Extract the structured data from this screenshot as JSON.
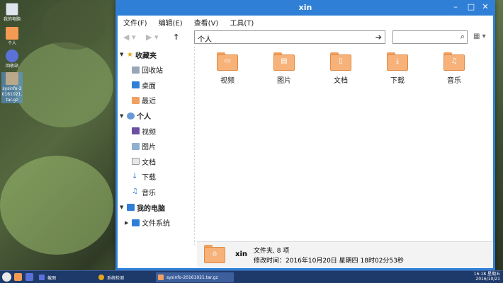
{
  "desktop": {
    "icons": [
      {
        "label": "我的电脑",
        "icon": "computer-icon"
      },
      {
        "label": "个人",
        "icon": "home-icon"
      },
      {
        "label": "回收站",
        "icon": "trash-icon"
      },
      {
        "label": "sysinfo-20161021.tar.gz",
        "icon": "archive-icon"
      }
    ]
  },
  "window": {
    "title": "xin",
    "menu": [
      "文件(F)",
      "编辑(E)",
      "查看(V)",
      "工具(T)"
    ],
    "address": "个人",
    "search_value": "",
    "sidebar": {
      "favorites": {
        "label": "收藏夹",
        "items": [
          "回收站",
          "桌面",
          "最近"
        ]
      },
      "personal": {
        "label": "个人",
        "items": [
          "视频",
          "图片",
          "文档",
          "下载",
          "音乐"
        ]
      },
      "computer": {
        "label": "我的电脑",
        "items": [
          "文件系统"
        ]
      }
    },
    "folders": [
      {
        "label": "视频",
        "icon": "video-icon",
        "sym": "▭"
      },
      {
        "label": "图片",
        "icon": "picture-icon",
        "sym": "▤"
      },
      {
        "label": "文档",
        "icon": "document-icon",
        "sym": "▯"
      },
      {
        "label": "下载",
        "icon": "download-icon",
        "sym": "⤓"
      },
      {
        "label": "音乐",
        "icon": "music-icon",
        "sym": "♫"
      }
    ],
    "status": {
      "name": "xin",
      "line1": "文件夹, 8 项",
      "line2": "修改时间：2016年10月20日 星期四 18时02分53秒"
    }
  },
  "taskbar": {
    "tasks": [
      "截图",
      "系统检测",
      "sysinfo-20161021.tar.gz"
    ],
    "time": "16:18 星期五",
    "date": "2016/10/21"
  },
  "colors": {
    "accent": "#2f7fd6",
    "folder": "#f7b27a",
    "taskbar": "#1e3a6a"
  }
}
